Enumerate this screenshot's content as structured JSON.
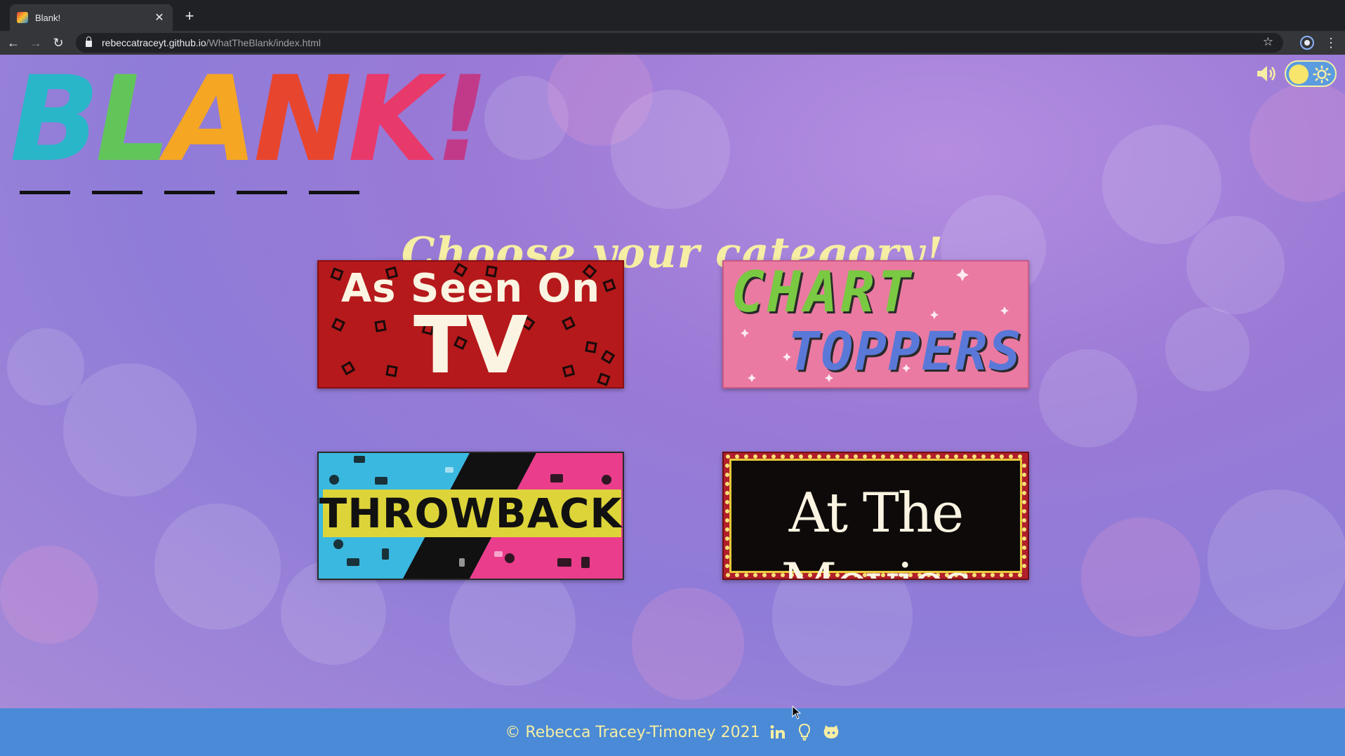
{
  "browser": {
    "tab_title": "Blank!",
    "url_host": "rebeccatraceyt.github.io",
    "url_path": "/WhatTheBlank/index.html"
  },
  "logo": {
    "text": "BLANK!",
    "letter_colors": [
      "#29b6c9",
      "#62c55a",
      "#f5a623",
      "#e8452e",
      "#e8396b",
      "#c13a8a"
    ],
    "blank_count": 5
  },
  "controls": {
    "sound_icon": "speaker-icon",
    "theme_toggle_icon": "sun-icon"
  },
  "main": {
    "heading": "Choose your category!"
  },
  "categories": [
    {
      "id": "tv",
      "lines": [
        "As Seen On",
        "TV"
      ]
    },
    {
      "id": "chart",
      "lines": [
        "CHART",
        "TOPPERS"
      ]
    },
    {
      "id": "throwback",
      "lines": [
        "THROWBACK"
      ]
    },
    {
      "id": "movies",
      "lines": [
        "At The Movies"
      ]
    }
  ],
  "footer": {
    "copyright": "© Rebecca Tracey-Timoney 2021",
    "icons": [
      "linkedin-icon",
      "lightbulb-icon",
      "github-icon"
    ]
  },
  "colors": {
    "accent_yellow": "#f6eea4",
    "footer_blue": "#4a8ad6"
  }
}
